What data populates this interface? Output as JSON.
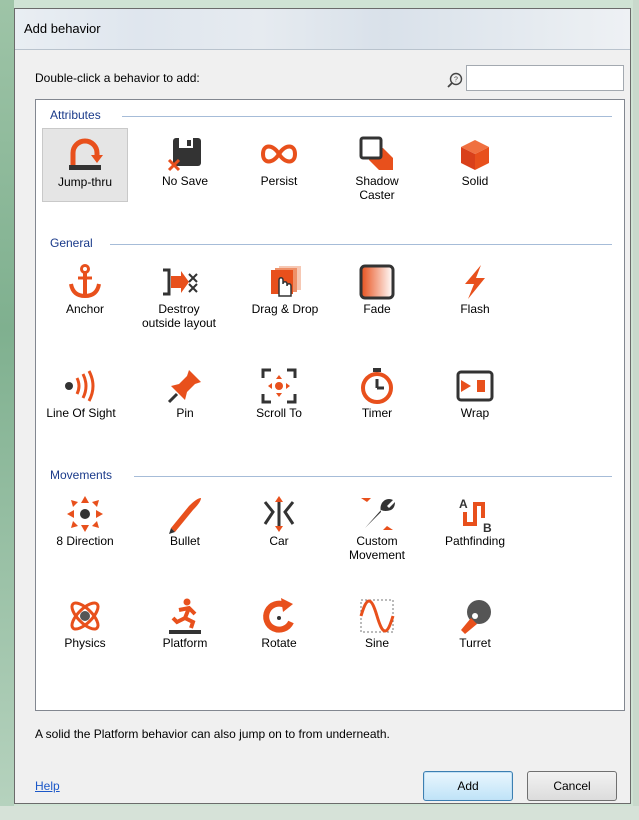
{
  "window": {
    "title": "Add behavior"
  },
  "prompt": "Double-click a behavior to add:",
  "search": {
    "value": "",
    "placeholder": ""
  },
  "groups": {
    "attributes": {
      "label": "Attributes",
      "items": [
        {
          "label": "Jump-thru",
          "icon": "jump-thru-icon"
        },
        {
          "label": "No Save",
          "icon": "no-save-icon"
        },
        {
          "label": "Persist",
          "icon": "infinity-icon"
        },
        {
          "label": "Shadow\nCaster",
          "icon": "shadow-caster-icon"
        },
        {
          "label": "Solid",
          "icon": "solid-cube-icon"
        }
      ]
    },
    "general": {
      "label": "General",
      "items": [
        {
          "label": "Anchor",
          "icon": "anchor-icon"
        },
        {
          "label": "Destroy\noutside layout",
          "icon": "destroy-icon"
        },
        {
          "label": "Drag & Drop",
          "icon": "drag-drop-icon"
        },
        {
          "label": "Fade",
          "icon": "fade-icon"
        },
        {
          "label": "Flash",
          "icon": "flash-icon"
        },
        {
          "label": "Line Of Sight",
          "icon": "line-of-sight-icon"
        },
        {
          "label": "Pin",
          "icon": "pin-icon"
        },
        {
          "label": "Scroll To",
          "icon": "scroll-to-icon"
        },
        {
          "label": "Timer",
          "icon": "timer-icon"
        },
        {
          "label": "Wrap",
          "icon": "wrap-icon"
        }
      ]
    },
    "movements": {
      "label": "Movements",
      "items": [
        {
          "label": "8 Direction",
          "icon": "eight-direction-icon"
        },
        {
          "label": "Bullet",
          "icon": "bullet-icon"
        },
        {
          "label": "Car",
          "icon": "car-icon"
        },
        {
          "label": "Custom\nMovement",
          "icon": "custom-movement-icon"
        },
        {
          "label": "Pathfinding",
          "icon": "pathfinding-icon"
        },
        {
          "label": "Physics",
          "icon": "physics-icon"
        },
        {
          "label": "Platform",
          "icon": "platform-icon"
        },
        {
          "label": "Rotate",
          "icon": "rotate-icon"
        },
        {
          "label": "Sine",
          "icon": "sine-icon"
        },
        {
          "label": "Turret",
          "icon": "turret-icon"
        }
      ]
    }
  },
  "selected": "Jump-thru",
  "status": "A solid the Platform behavior can also jump on to from underneath.",
  "footer": {
    "help": "Help",
    "add": "Add",
    "cancel": "Cancel"
  },
  "colors": {
    "accent": "#e8501c",
    "header": "#1a3a8a",
    "dark": "#333333"
  }
}
